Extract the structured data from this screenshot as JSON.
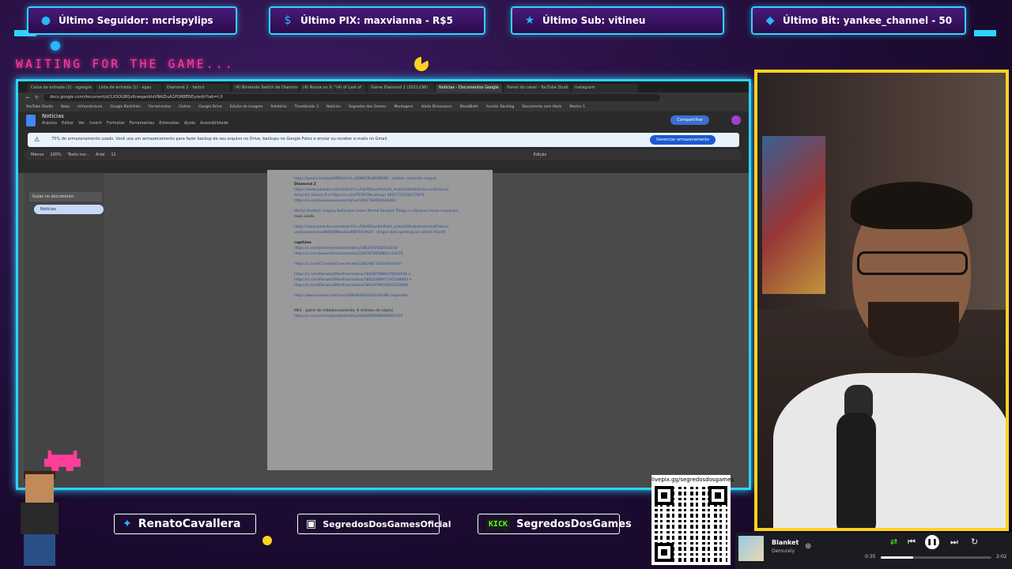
{
  "stats": [
    {
      "icon": "person",
      "text": "Último Seguidor: mcrispylips"
    },
    {
      "icon": "dollar",
      "text": "Último PIX: maxvianna - R$5"
    },
    {
      "icon": "star",
      "text": "Último Sub: vitineu"
    },
    {
      "icon": "diamond",
      "text": "Último Bit: yankee_channel - 50"
    }
  ],
  "waiting_text": "WAITING FOR THE GAME...",
  "browser": {
    "tabs": [
      "Caixa de entrada (1) - egsegre",
      "Lista de entrada (1) - egsu",
      "Diamond 2 - twitch",
      "(4) Nintendo Switch de Diamond d",
      "(4) Nossa no X: \"(4) of Last of",
      "Game Diamond 2 (2021)(96)",
      "Notícias - Documentos Google",
      "Painel do canal - YouTube Studi",
      "Instagram"
    ],
    "active_tab": 6,
    "url": "docs.google.com/document/d/12OOGBQu6nwqanbtzVNAZtuA1PQRBENDy/edit?tab=t.0",
    "bookmarks": [
      "YouTube Studio",
      "Keep",
      "Infraestrutura",
      "Google Backlinks",
      "Ferramentas",
      "Outros",
      "Google Drive",
      "Edição de imagem",
      "Relatório",
      "Thumbnails 3",
      "Notícias",
      "Segredos dos Games",
      "Montagem",
      "Idiota Dinossauro",
      "BloodBath",
      "Assistir Backlog",
      "Documento sem título",
      "Marlon 1"
    ]
  },
  "docs": {
    "title": "Notícias",
    "menu": [
      "Arquivo",
      "Editar",
      "Ver",
      "Inserir",
      "Formatar",
      "Ferramentas",
      "Extensões",
      "Ajuda",
      "Acessibilidade"
    ],
    "share": "Compartilhar",
    "storage_banner": "75% do armazenamento usado. Você usa um armazenamento para fazer backup de seu arquivo no Drive, backups no Google Fotos e enviar ou receber e-mails no Gmail.",
    "storage_button": "Gerenciar armazenamento",
    "toolbar": [
      "Menus",
      "100%",
      "Texto nor...",
      "Arial",
      "11",
      "Edição"
    ],
    "outline_label": "Guias no documento",
    "outline_item": "Notícias",
    "lines": [
      {
        "t": "https://youtu.be/eJuiyKRBzOc?si=KDKOOEaMdDDf6l - melhor conteúdo sequel",
        "k": "link"
      },
      {
        "t": "Diamond 2",
        "k": "dark"
      },
      {
        "t": "https://www.youtube.com/watch?v=RijkWQuelhhAaht_mobileE8mbdersecondChance",
        "k": "link"
      },
      {
        "t": "America: linkers 0 e https://x.com/TEAYZNmafoua/ 1821774136177970",
        "k": "link"
      },
      {
        "t": "https://x.com/peeeneeerees/status/1862768650642883",
        "k": "link"
      },
      {
        "t": "",
        "k": "gap"
      },
      {
        "t": "Mortal Kombat: Legacy Kollection reúne Mortal Kombat Trilogy e clássicos Focus e podcast",
        "k": "link"
      },
      {
        "t": "mais ainda",
        "k": "plain"
      },
      {
        "t": "",
        "k": "gap"
      },
      {
        "t": "https://www.youtube.com/watch?v=RijkWQuelhhAaht_mobileE8mbdersecondChance",
        "k": "link"
      },
      {
        "t": "unrevealedcrew/88OVBNanEaaBBYlOInPi20 - dragon ball sparking no switch R$339",
        "k": "link"
      },
      {
        "t": "",
        "k": "gap"
      },
      {
        "t": "capitões",
        "k": "dark"
      },
      {
        "t": "https://x.com/peseeleestatus/status/1862692502914233",
        "k": "link"
      },
      {
        "t": "https://x.com/peaoidimasasestatus/1862878598861143676",
        "k": "link"
      },
      {
        "t": "",
        "k": "gap"
      },
      {
        "t": "https://x.com/Clickbait/Coordenada/1862887160184/04047",
        "k": "link"
      },
      {
        "t": "",
        "k": "gap"
      },
      {
        "t": "https://x.com/Renato/DRedfroomtatus/1861879882070/02038 e",
        "k": "link"
      },
      {
        "t": "https://x.com/Renato/DRedfroomtatus/1862268907192168893 e",
        "k": "link"
      },
      {
        "t": "https://x.com/Renato/DRedfroomtatus/1861878615001610406",
        "k": "link"
      },
      {
        "t": "",
        "k": "gap"
      },
      {
        "t": "https://www.kamen.net/mario/86983856120230188 esquerdos",
        "k": "link"
      },
      {
        "t": "",
        "k": "gap"
      },
      {
        "t": "",
        "k": "gap"
      },
      {
        "t": "MK1 - patch de rebalanceamento, 6 milhões de cópias",
        "k": "plain"
      },
      {
        "t": "https://x.com/mortalkombat/status/1862689998008001479",
        "k": "link"
      }
    ]
  },
  "socials": [
    {
      "icon": "twitter",
      "text": "RenatoCavallera"
    },
    {
      "icon": "instagram",
      "text": "SegredosDosGamesOficial"
    },
    {
      "icon": "kick",
      "badge": "KICK",
      "text": "SegredosDosGames"
    }
  ],
  "qr_caption": "livepix.gg/segredosdosgames",
  "player": {
    "track": "Blanket",
    "artist": "Demurely",
    "elapsed": "0:35",
    "duration": "2:02",
    "progress": 0.29
  },
  "colors": {
    "accent": "#2fd3ff",
    "pink": "#ff3d9a",
    "yellow": "#ffd21f",
    "bg": "#1d0b33"
  }
}
